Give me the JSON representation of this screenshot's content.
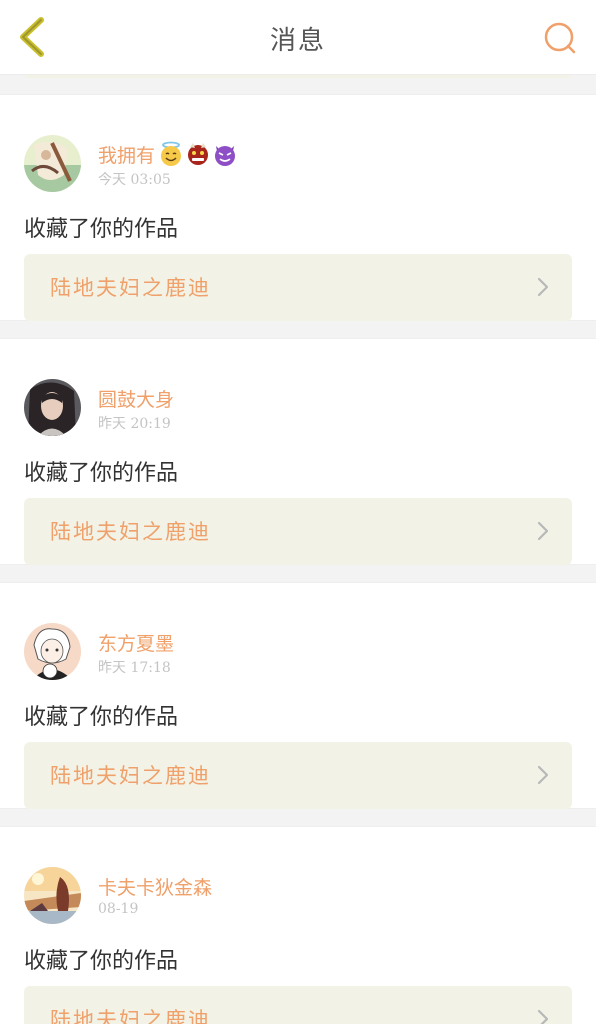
{
  "header": {
    "title": "消息",
    "back_icon": "chevron-left-icon",
    "search_icon": "search-icon",
    "accent_color": "#f0a06a",
    "back_color": "#c9bf2d"
  },
  "messages": [
    {
      "username": "我拥有",
      "emojis": [
        "smiling-face-with-halo",
        "ogre-face",
        "smiling-imp"
      ],
      "time": "今天 03:05",
      "action": "收藏了你的作品",
      "work_title": "陆地夫妇之鹿迪"
    },
    {
      "username": "圆鼓大身",
      "emojis": [],
      "time": "昨天 20:19",
      "action": "收藏了你的作品",
      "work_title": "陆地夫妇之鹿迪"
    },
    {
      "username": "东方夏墨",
      "emojis": [],
      "time": "昨天 17:18",
      "action": "收藏了你的作品",
      "work_title": "陆地夫妇之鹿迪"
    },
    {
      "username": "卡夫卡狄金森",
      "emojis": [],
      "time": "08-19",
      "action": "收藏了你的作品",
      "work_title": "陆地夫妇之鹿迪"
    }
  ]
}
